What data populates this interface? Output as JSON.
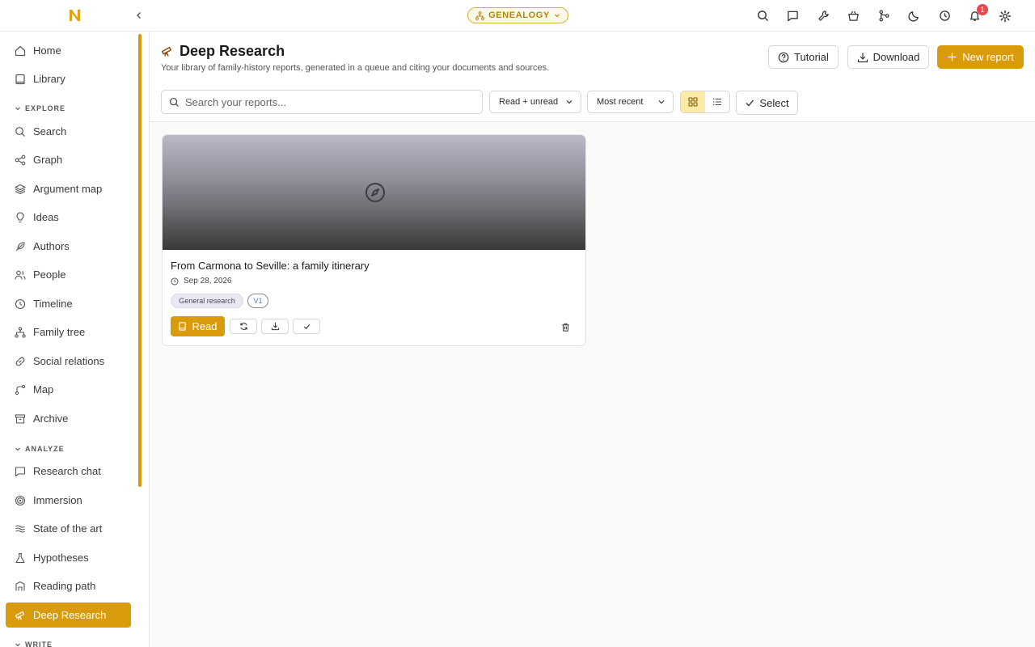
{
  "topbar": {
    "workspace_label": "GENEALOGY",
    "notification_count": "1",
    "icons": [
      "search-icon",
      "chat-icon",
      "wrench-icon",
      "basket-icon",
      "merge-icon",
      "moon-icon",
      "clock-icon",
      "bell-icon",
      "gear-icon"
    ]
  },
  "sidebar": {
    "home": "Home",
    "library": "Library",
    "explore_label": "EXPLORE",
    "explore": [
      "Search",
      "Graph",
      "Argument map",
      "Ideas",
      "Authors",
      "People",
      "Timeline",
      "Family tree",
      "Social relations",
      "Map",
      "Archive"
    ],
    "analyze_label": "ANALYZE",
    "analyze": [
      "Research chat",
      "Immersion",
      "State of the art",
      "Hypotheses",
      "Reading path",
      "Deep Research"
    ],
    "write_label": "WRITE",
    "active": "Deep Research"
  },
  "header": {
    "title": "Deep Research",
    "subtitle": "Your library of family-history reports, generated in a queue and citing your documents and sources.",
    "tutorial": "Tutorial",
    "download": "Download",
    "new_report": "New report"
  },
  "toolbar": {
    "search_placeholder": "Search your reports...",
    "read_filter": "Read + unread",
    "sort": "Most recent",
    "view_mode": "grid",
    "select": "Select"
  },
  "reports": [
    {
      "title": "From Carmona to Seville: a family itinerary",
      "date": "Sep 28, 2026",
      "tag": "General research",
      "version": "V1",
      "read_label": "Read"
    }
  ],
  "colors": {
    "accent": "#d99a0b",
    "badge": "#e5484d"
  }
}
